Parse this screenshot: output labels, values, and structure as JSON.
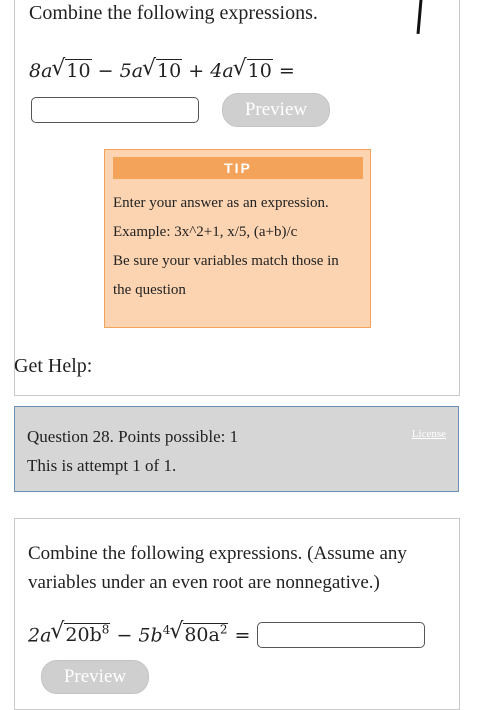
{
  "question1": {
    "prompt": "Combine the following expressions.",
    "expression": {
      "t1_coef": "8a",
      "t1_rad": "10",
      "op1": "−",
      "t2_coef": "5a",
      "t2_rad": "10",
      "op2": "+",
      "t3_coef": "4a",
      "t3_rad": "10",
      "eq": "="
    },
    "answer_value": "",
    "preview_label": "Preview"
  },
  "tip": {
    "heading": "TIP",
    "line1": "Enter your answer as an expression.",
    "line2": "Example: 3x^2+1, x/5, (a+b)/c",
    "line3": "Be sure your variables match those in",
    "line4": "the question"
  },
  "get_help": "Get Help:",
  "question_info": {
    "line1": "Question 28. Points possible: 1",
    "line2": "This is attempt 1 of 1.",
    "license": "License"
  },
  "question2": {
    "prompt": "Combine the following expressions. (Assume any variables under an even root are nonnegative.)",
    "expression": {
      "t1_coef": "2a",
      "t1_rad_base": "20b",
      "t1_rad_exp": "8",
      "op": "−",
      "t2_coef": "5b",
      "t2_coef_exp": "4",
      "t2_rad_base": "80a",
      "t2_rad_exp": "2",
      "eq": "="
    },
    "answer_value": "",
    "preview_label": "Preview"
  }
}
